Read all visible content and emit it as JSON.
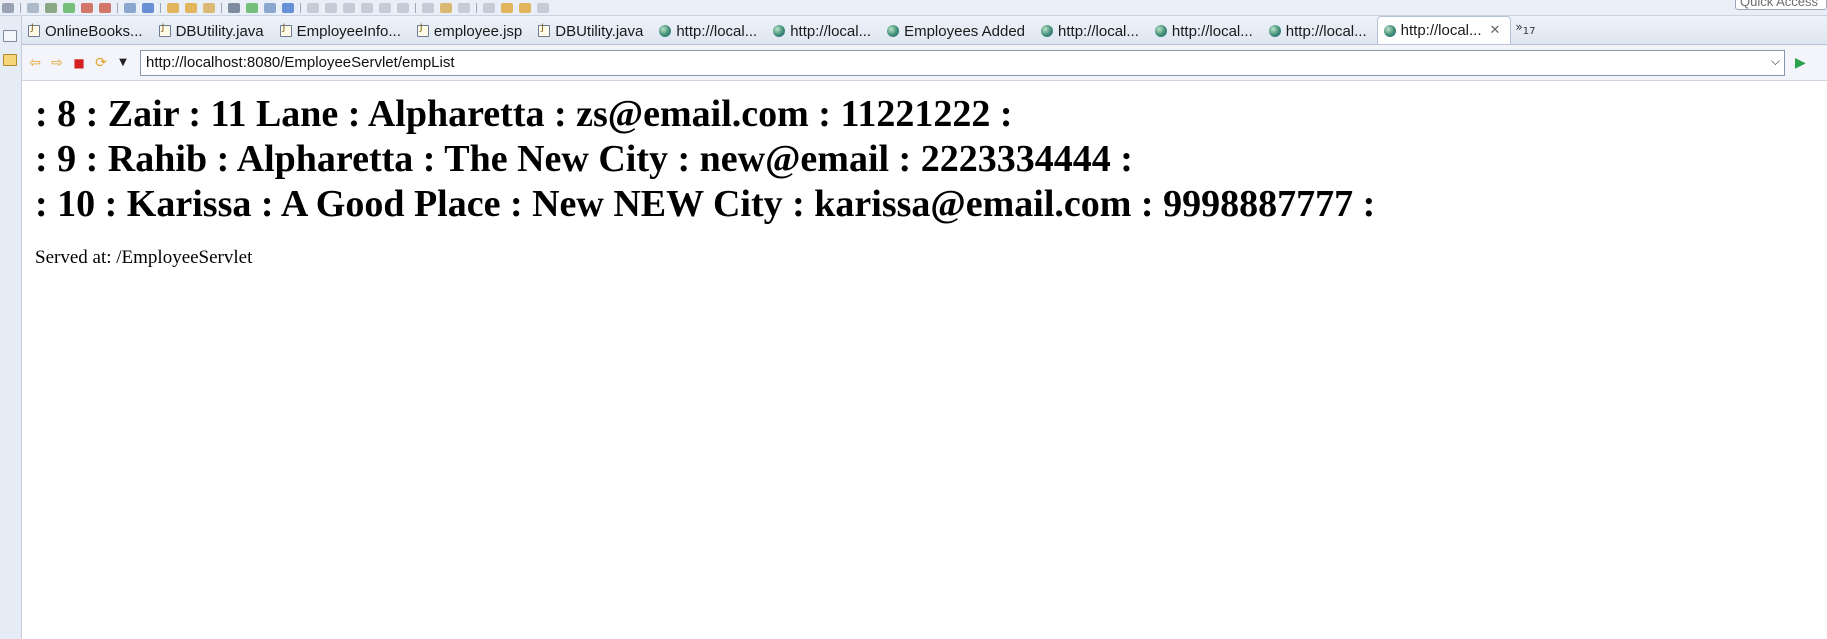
{
  "toolbar": {
    "quick_access": "Quick Access"
  },
  "tabs": [
    {
      "label": "OnlineBooks...",
      "icon": "java-file-icon",
      "active": false
    },
    {
      "label": "DBUtility.java",
      "icon": "java-file-icon",
      "active": false
    },
    {
      "label": "EmployeeInfo...",
      "icon": "java-file-icon",
      "active": false
    },
    {
      "label": "employee.jsp",
      "icon": "jsp-file-icon",
      "active": false
    },
    {
      "label": "DBUtility.java",
      "icon": "java-file-icon",
      "active": false
    },
    {
      "label": "http://local...",
      "icon": "globe-icon",
      "active": false
    },
    {
      "label": "http://local...",
      "icon": "globe-icon",
      "active": false
    },
    {
      "label": "Employees Added",
      "icon": "globe-icon",
      "active": false
    },
    {
      "label": "http://local...",
      "icon": "globe-icon",
      "active": false
    },
    {
      "label": "http://local...",
      "icon": "globe-icon",
      "active": false
    },
    {
      "label": "http://local...",
      "icon": "globe-icon",
      "active": false
    },
    {
      "label": "http://local...",
      "icon": "globe-icon",
      "active": true
    }
  ],
  "tab_overflow": {
    "symbol": "»",
    "count": "17"
  },
  "navigation": {
    "url": "http://localhost:8080/EmployeeServlet/empList"
  },
  "content": {
    "employees": [
      ": 8 : Zair : 11 Lane : Alpharetta : zs@email.com : 11221222 :",
      ": 9 : Rahib : Alpharetta : The New City : new@email : 2223334444 :",
      ": 10 : Karissa : A Good Place : New NEW City : karissa@email.com : 9998887777 :"
    ],
    "served_at": "Served at: /EmployeeServlet"
  },
  "colors": {
    "tabbar_bg": "#e4eaf4",
    "link_text": "#000000",
    "stop": "#d42020",
    "nav_arrow": "#e0a32a",
    "go": "#2aa14a"
  }
}
